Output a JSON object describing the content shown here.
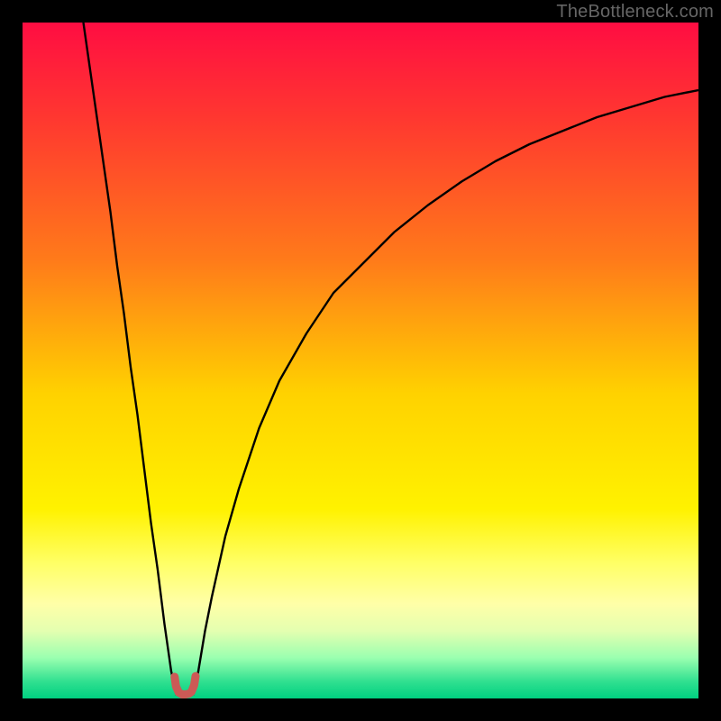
{
  "watermark": "TheBottleneck.com",
  "chart_data": {
    "type": "line",
    "title": "",
    "xlabel": "",
    "ylabel": "",
    "xlim": [
      0,
      100
    ],
    "ylim": [
      0,
      100
    ],
    "grid": false,
    "legend": false,
    "gradient_stops": [
      {
        "offset": 0.0,
        "color": "#ff0d42"
      },
      {
        "offset": 0.15,
        "color": "#ff3a2f"
      },
      {
        "offset": 0.35,
        "color": "#ff7a1a"
      },
      {
        "offset": 0.55,
        "color": "#ffd200"
      },
      {
        "offset": 0.72,
        "color": "#fff200"
      },
      {
        "offset": 0.8,
        "color": "#ffff66"
      },
      {
        "offset": 0.86,
        "color": "#ffffa8"
      },
      {
        "offset": 0.9,
        "color": "#e4ffb0"
      },
      {
        "offset": 0.94,
        "color": "#9affb0"
      },
      {
        "offset": 0.975,
        "color": "#30e090"
      },
      {
        "offset": 1.0,
        "color": "#00d080"
      }
    ],
    "series": [
      {
        "name": "left-limb",
        "stroke": "#000000",
        "width": 2.4,
        "x": [
          9,
          10,
          11,
          12,
          13,
          14,
          15,
          16,
          17,
          18,
          19,
          20,
          21,
          22,
          22.8
        ],
        "y": [
          100,
          93,
          86,
          79,
          72,
          64,
          57,
          49,
          42,
          34,
          26,
          19,
          11,
          4,
          0.5
        ]
      },
      {
        "name": "right-limb",
        "stroke": "#000000",
        "width": 2.4,
        "x": [
          25.2,
          26,
          27,
          28,
          30,
          32,
          35,
          38,
          42,
          46,
          50,
          55,
          60,
          65,
          70,
          75,
          80,
          85,
          90,
          95,
          100
        ],
        "y": [
          0.5,
          4,
          10,
          15,
          24,
          31,
          40,
          47,
          54,
          60,
          64,
          69,
          73,
          76.5,
          79.5,
          82,
          84,
          86,
          87.5,
          89,
          90
        ]
      },
      {
        "name": "valley-marker",
        "stroke": "#cc5a56",
        "width": 9,
        "cap": "round",
        "x": [
          22.5,
          22.7,
          23.1,
          23.6,
          24.1,
          24.6,
          25.0,
          25.4,
          25.6
        ],
        "y": [
          3.2,
          1.8,
          0.9,
          0.6,
          0.6,
          0.7,
          1.0,
          2.0,
          3.3
        ]
      }
    ]
  }
}
